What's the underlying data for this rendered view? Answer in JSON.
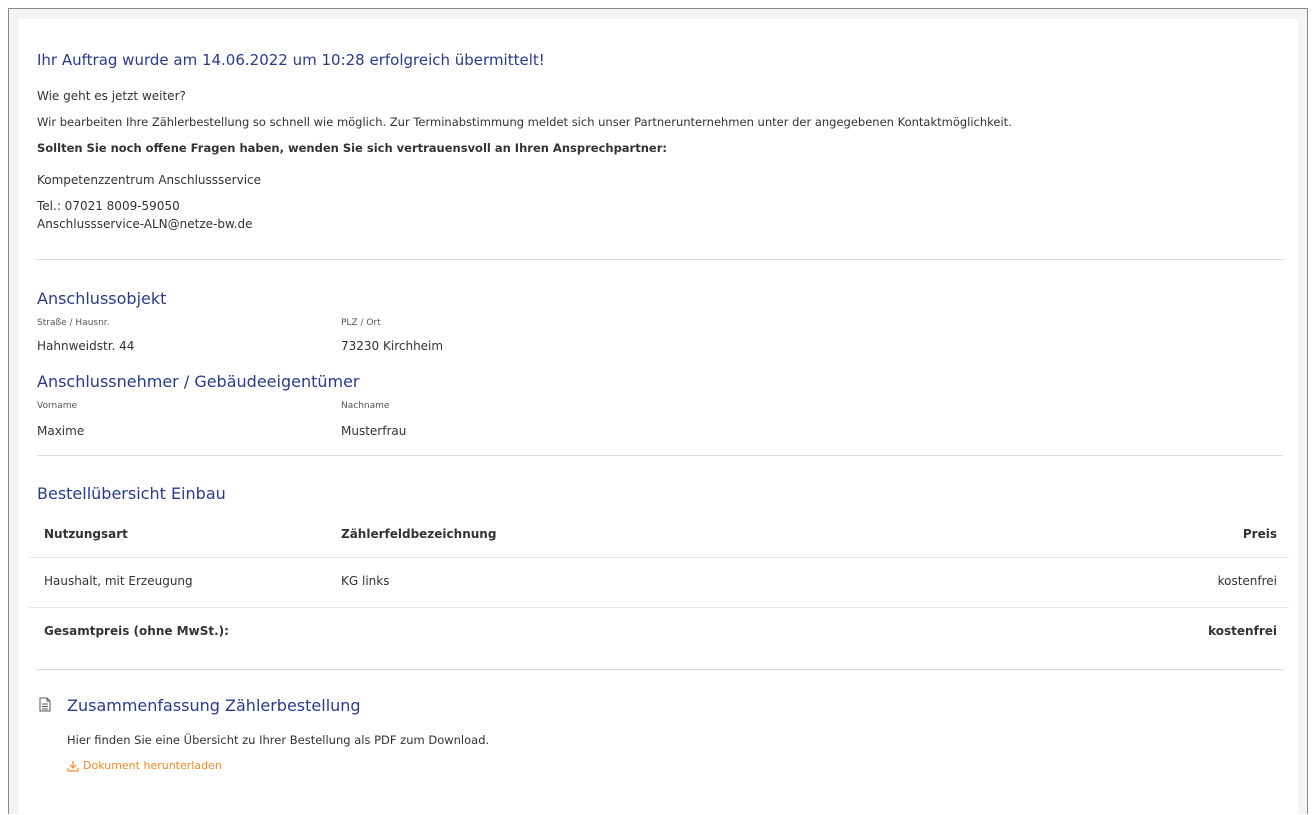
{
  "confirmation": {
    "title": "Ihr Auftrag wurde am 14.06.2022 um 10:28 erfolgreich übermittelt!",
    "next_heading": "Wie geht es jetzt weiter?",
    "next_text": "Wir bearbeiten Ihre Zählerbestellung so schnell wie möglich. Zur Terminabstimmung meldet sich unser Partnerunternehmen unter der angegebenen Kontaktmöglichkeit.",
    "questions_text": "Sollten Sie noch offene Fragen haben, wenden Sie sich vertrauensvoll an Ihren Ansprechpartner:",
    "contact_name": "Kompetenzzentrum Anschlussservice",
    "contact_phone": "Tel.: 07021 8009-59050",
    "contact_email": "Anschlussservice-ALN@netze-bw.de"
  },
  "anschlussobjekt": {
    "title": "Anschlussobjekt",
    "street_label": "Straße / Hausnr.",
    "street_value": "Hahnweidstr. 44",
    "city_label": "PLZ / Ort",
    "city_value": "73230 Kirchheim"
  },
  "anschlussnehmer": {
    "title": "Anschlussnehmer / Gebäudeeigentümer",
    "firstname_label": "Vorname",
    "firstname_value": "Maxime",
    "lastname_label": "Nachname",
    "lastname_value": "Musterfrau"
  },
  "order": {
    "title": "Bestellübersicht Einbau",
    "columns": [
      "Nutzungsart",
      "Zählerfeldbezeichnung",
      "Preis"
    ],
    "rows": [
      {
        "nutzungsart": "Haushalt, mit Erzeugung",
        "bezeichnung": "KG links",
        "preis": "kostenfrei"
      }
    ],
    "total_label": "Gesamtpreis (ohne MwSt.):",
    "total_value": "kostenfrei"
  },
  "summary": {
    "title": "Zusammenfassung Zählerbestellung",
    "text": "Hier finden Sie eine Übersicht zu Ihrer Bestellung als PDF zum Download.",
    "download_label": "Dokument herunterladen",
    "icon": "document-icon",
    "download_icon": "download-icon"
  },
  "colors": {
    "accent_blue": "#2b3a8f",
    "accent_orange": "#f08a24"
  }
}
